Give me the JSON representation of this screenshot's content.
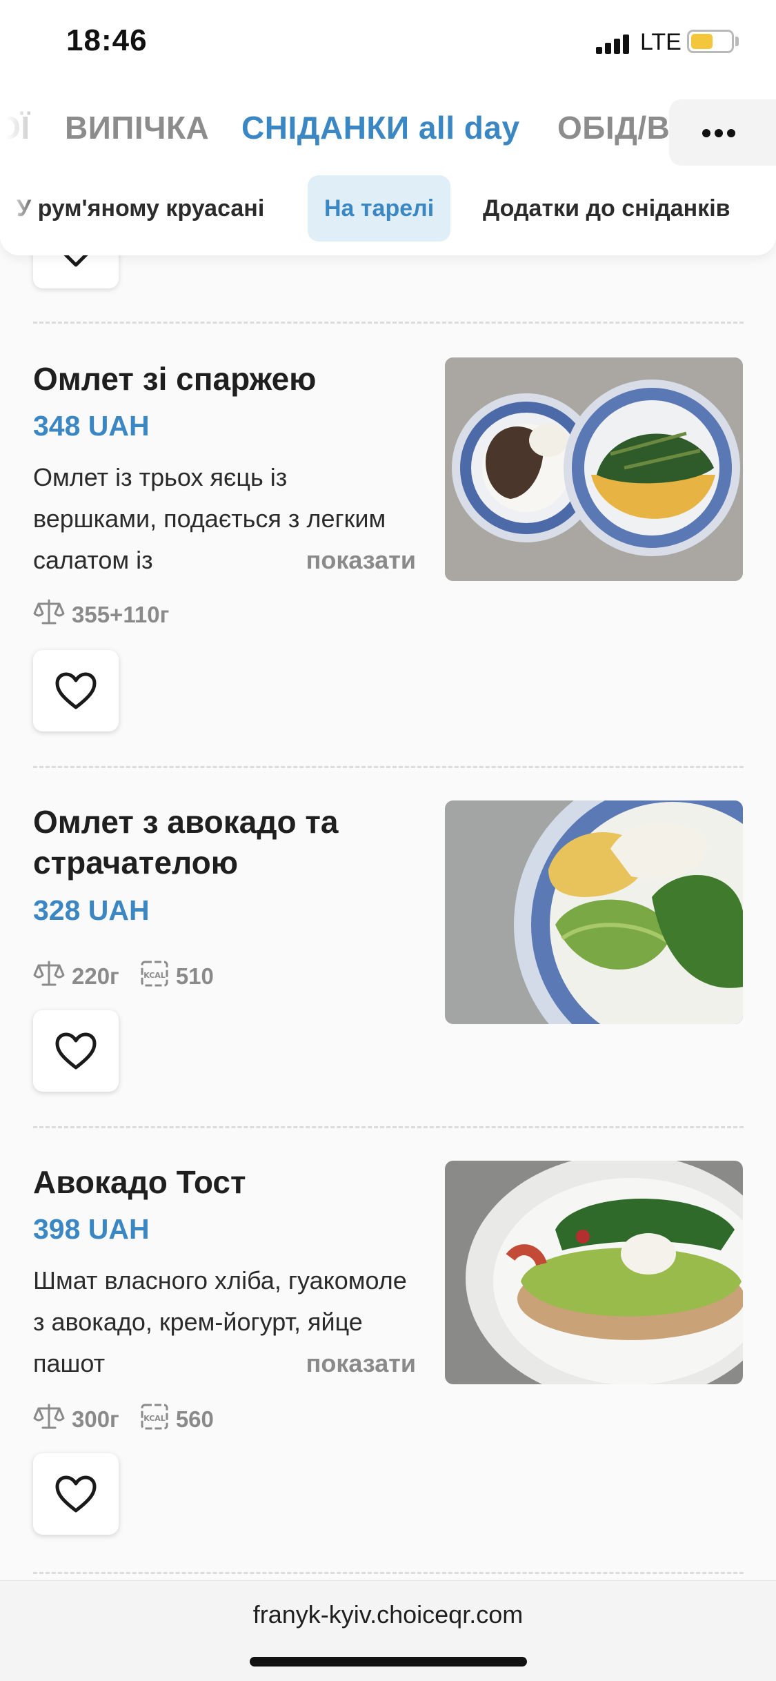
{
  "status_bar": {
    "time": "18:46",
    "network": "LTE",
    "battery_level": 0.55,
    "battery_color": "#f4c63b"
  },
  "categories": {
    "items": [
      {
        "label": "ОЇ"
      },
      {
        "label": "ВИПІЧКА"
      },
      {
        "label": "СНІДАНКИ all day",
        "active": true
      },
      {
        "label": "ОБІД/В"
      }
    ],
    "more_icon": "more-horizontal-icon"
  },
  "subcategories": {
    "items": [
      {
        "label": "У рум'яному круасані"
      },
      {
        "label": "На тарелі",
        "active": true
      },
      {
        "label": "Додатки до сніданків"
      }
    ]
  },
  "items": [
    {
      "title": "Омлет зі спаржею",
      "price": "348 UAH",
      "description": "Омлет із трьох яєць із вершками, подається з легким салатом із",
      "show_more": "показати",
      "weight": "355+110г",
      "image_icon": "omelette-asparagus-photo"
    },
    {
      "title": "Омлет з авокадо та страчателою",
      "price": "328 UAH",
      "weight": "220г",
      "kcal": "510",
      "image_icon": "omelette-avocado-photo"
    },
    {
      "title": "Авокадо Тост",
      "price": "398 UAH",
      "description": "Шмат власного хліба, гуакомоле з авокадо, крем-йогурт, яйце пашот",
      "show_more": "показати",
      "weight": "300г",
      "kcal": "560",
      "image_icon": "avocado-toast-photo"
    }
  ],
  "browser": {
    "url": "franyk-kyiv.choiceqr.com"
  },
  "colors": {
    "accent": "#3b87c4",
    "accent_bg": "#dfeef7",
    "muted": "#8a8a8a"
  }
}
